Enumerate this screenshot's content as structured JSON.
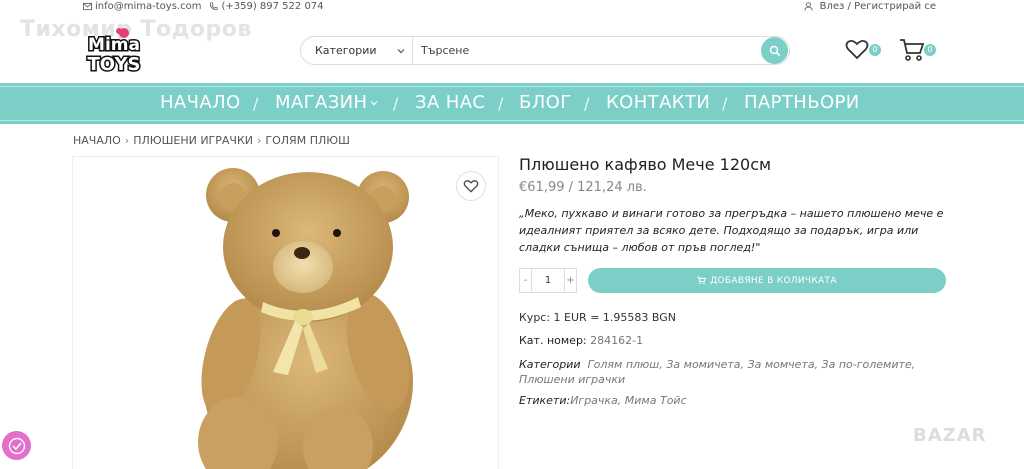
{
  "topbar": {
    "email": "info@mima-toys.com",
    "phone": "(+359) 897 522 074",
    "login": "Влез / Регистрирай се"
  },
  "watermark": "Тихомир Тодоров",
  "logo": {
    "line1": "Mima",
    "line2": "TOYS"
  },
  "search": {
    "category_label": "Категории",
    "placeholder": "Търсене"
  },
  "header": {
    "wishlist_count": "0",
    "cart_count": "0"
  },
  "nav": {
    "items": [
      "НАЧАЛО",
      "МАГАЗИН",
      "ЗА НАС",
      "БЛОГ",
      "КОНТАКТИ",
      "ПАРТНЬОРИ"
    ]
  },
  "breadcrumb": [
    "НАЧАЛО",
    "ПЛЮШЕНИ ИГРАЧКИ",
    "ГОЛЯМ ПЛЮШ"
  ],
  "product": {
    "title": "Плюшено кафяво Мече 120см",
    "price": "€61,99 / 121,24 лв.",
    "description": "„Меко, пухкаво и винаги готово за прегръдка – нашето плюшено мече е идеалният приятел за всяко дете. Подходящо за подарък, игра или сладки сънища – любов от пръв поглед!\"",
    "qty_minus": "-",
    "qty": "1",
    "qty_plus": "+",
    "add_to_cart": "ДОБАВЯНЕ В КОЛИЧКАТА",
    "rate_label": "Курс: 1 EUR = 1.95583 BGN",
    "sku_label": "Кат. номер:",
    "sku": "284162-1",
    "categories_label": "Категории",
    "categories": "Голям плюш, За момичета, За момчета, За по-големите, Плюшени играчки",
    "tags_label": "Етикети:",
    "tags": "Играчка, Мима Тойс"
  },
  "bazar": "BAZAR",
  "colors": {
    "accent": "#7ccfc6",
    "fab": "#e36ecc"
  }
}
